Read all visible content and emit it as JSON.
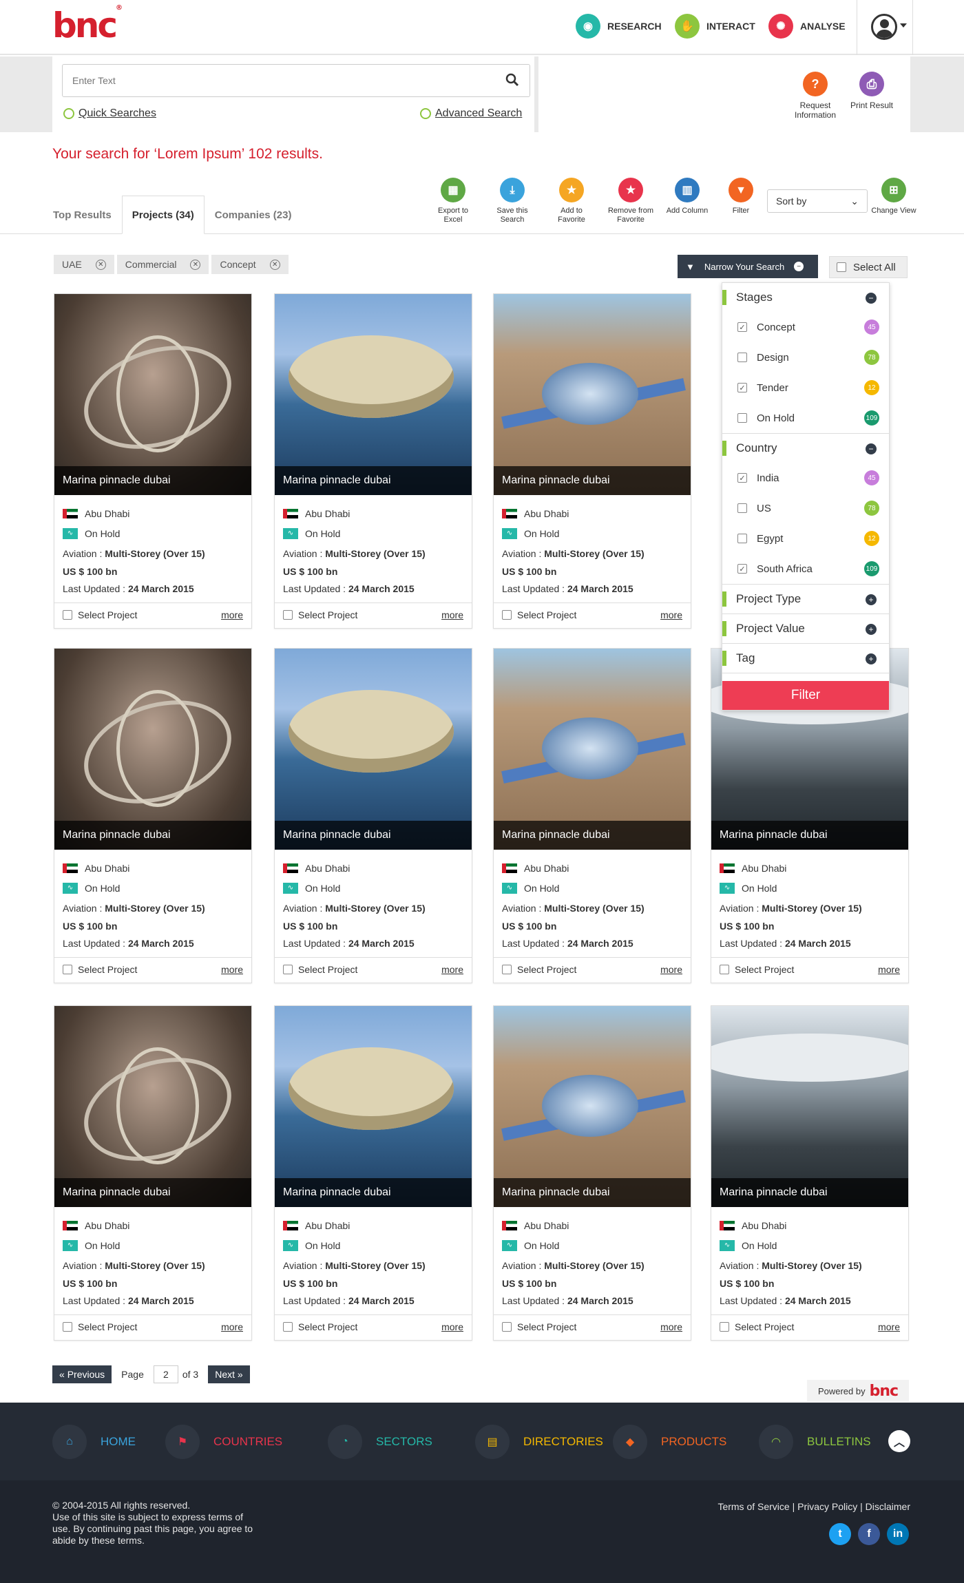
{
  "brand": {
    "logo": "bnc",
    "reg": "®",
    "colors": {
      "brand_red": "#d5202e",
      "teal": "#25b8a8",
      "green": "#8dc63f",
      "dark": "#252b35"
    }
  },
  "topnav": [
    {
      "label": "RESEARCH",
      "icon": "eye-icon",
      "color": "#25b8a8"
    },
    {
      "label": "INTERACT",
      "icon": "handshake-icon",
      "color": "#8dc63f"
    },
    {
      "label": "ANALYSE",
      "icon": "brain-icon",
      "color": "#e8344c"
    }
  ],
  "search": {
    "placeholder": "Enter Text",
    "quick": "Quick Searches",
    "advanced": "Advanced Search"
  },
  "right_tools": [
    {
      "label": "Request Information",
      "icon": "question-icon",
      "color": "#f26522"
    },
    {
      "label": "Print Result",
      "icon": "printer-icon",
      "color": "#8e5bb5"
    }
  ],
  "results": {
    "text": "Your search for ‘Lorem Ipsum’ 102 results."
  },
  "tabs": [
    {
      "label": "Top Results"
    },
    {
      "label": "Projects (34)"
    },
    {
      "label": "Companies (23)"
    }
  ],
  "tools": [
    {
      "label": "Export to Excel",
      "icon": "excel-icon",
      "color": "#5fa845"
    },
    {
      "label": "Save this Search",
      "icon": "save-icon",
      "color": "#3aa3dc"
    },
    {
      "label": "Add to Favorite",
      "icon": "star-plus-icon",
      "color": "#f5a623"
    },
    {
      "label": "Remove from Favorite",
      "icon": "star-minus-icon",
      "color": "#e8344c"
    },
    {
      "label": "Add Column",
      "icon": "columns-icon",
      "color": "#2f7ac0"
    },
    {
      "label": "Filter",
      "icon": "filter-icon",
      "color": "#f26522"
    },
    {
      "label": "Change View",
      "icon": "grid-icon",
      "color": "#5fa845"
    }
  ],
  "sort": {
    "label": "Sort by"
  },
  "chips": [
    {
      "label": "UAE"
    },
    {
      "label": "Commercial"
    },
    {
      "label": "Concept"
    }
  ],
  "narrow": {
    "label": "Narrow Your Search"
  },
  "select_all": "Select All",
  "card": {
    "title": "Marina pinnacle dubai",
    "location": "Abu Dhabi",
    "status": "On Hold",
    "sector_label": "Aviation",
    "sector_value": "Multi-Storey (Over 15)",
    "value": "US $ 100 bn",
    "updated_label": "Last Updated",
    "updated_value": "24 March 2015",
    "select": "Select Project",
    "more": "more"
  },
  "filter": {
    "stages_title": "Stages",
    "stages": [
      {
        "label": "Concept",
        "count": "45",
        "checked": true,
        "color": "#c77ddb"
      },
      {
        "label": "Design",
        "count": "78",
        "checked": false,
        "color": "#8dc63f"
      },
      {
        "label": "Tender",
        "count": "12",
        "checked": true,
        "color": "#f5b800"
      },
      {
        "label": "On Hold",
        "count": "109",
        "checked": false,
        "color": "#1a9a6e"
      }
    ],
    "country_title": "Country",
    "countries": [
      {
        "label": "India",
        "count": "45",
        "checked": true,
        "color": "#c77ddb"
      },
      {
        "label": "US",
        "count": "78",
        "checked": false,
        "color": "#8dc63f"
      },
      {
        "label": "Egypt",
        "count": "12",
        "checked": false,
        "color": "#f5b800"
      },
      {
        "label": "South Africa",
        "count": "109",
        "checked": true,
        "color": "#1a9a6e"
      }
    ],
    "project_type": "Project Type",
    "project_value": "Project Value",
    "tag": "Tag",
    "button": "Filter"
  },
  "pager": {
    "prev": "Previous",
    "page_label": "Page",
    "page": "2",
    "of": "of 3",
    "next": "Next"
  },
  "powered": {
    "label": "Powered by",
    "logo": "bnc"
  },
  "footnav": [
    {
      "label": "HOME",
      "icon": "home-icon",
      "color": "#3aa3dc"
    },
    {
      "label": "COUNTRIES",
      "icon": "flag-icon",
      "color": "#e8344c"
    },
    {
      "label": "SECTORS",
      "icon": "pie-icon",
      "color": "#25b8a8"
    },
    {
      "label": "DIRECTORIES",
      "icon": "book-icon",
      "color": "#f5b800"
    },
    {
      "label": "PRODUCTS",
      "icon": "box-icon",
      "color": "#f26522"
    },
    {
      "label": "BULLETINS",
      "icon": "rss-icon",
      "color": "#8dc63f"
    }
  ],
  "footer": {
    "copyright": "© 2004-2015 All rights reserved.",
    "terms_text": "Use of this site is subject to express terms of use. By continuing past this page, you agree to abide by these terms.",
    "links": "Terms of Service | Privacy Policy | Disclaimer",
    "social": [
      {
        "label": "t",
        "icon": "twitter-icon"
      },
      {
        "label": "f",
        "icon": "facebook-icon"
      },
      {
        "label": "in",
        "icon": "linkedin-icon"
      }
    ]
  }
}
